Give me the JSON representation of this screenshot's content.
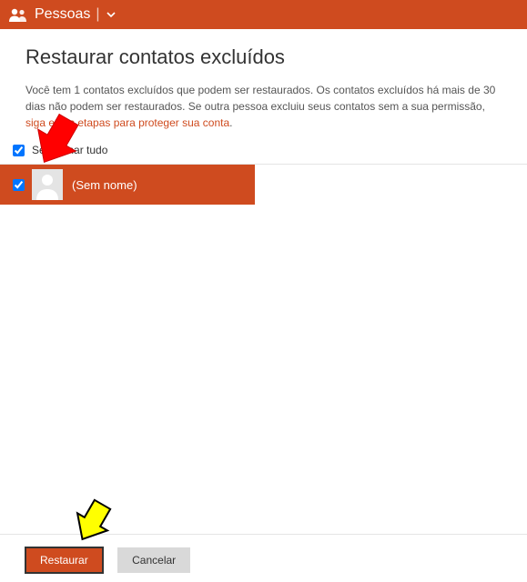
{
  "header": {
    "title": "Pessoas"
  },
  "page": {
    "title": "Restaurar contatos excluídos",
    "desc_pre": "Você tem 1 contatos excluídos que podem ser restaurados. Os contatos excluídos há mais de 30 dias não podem ser restaurados. Se outra pessoa excluiu seus contatos sem a sua permissão, ",
    "desc_link": "siga estas etapas para proteger sua conta",
    "desc_post": "."
  },
  "select_all": {
    "label": "Selecionar tudo",
    "checked": true
  },
  "contacts": [
    {
      "name": "(Sem nome)",
      "checked": true
    }
  ],
  "footer": {
    "restore": "Restaurar",
    "cancel": "Cancelar"
  }
}
